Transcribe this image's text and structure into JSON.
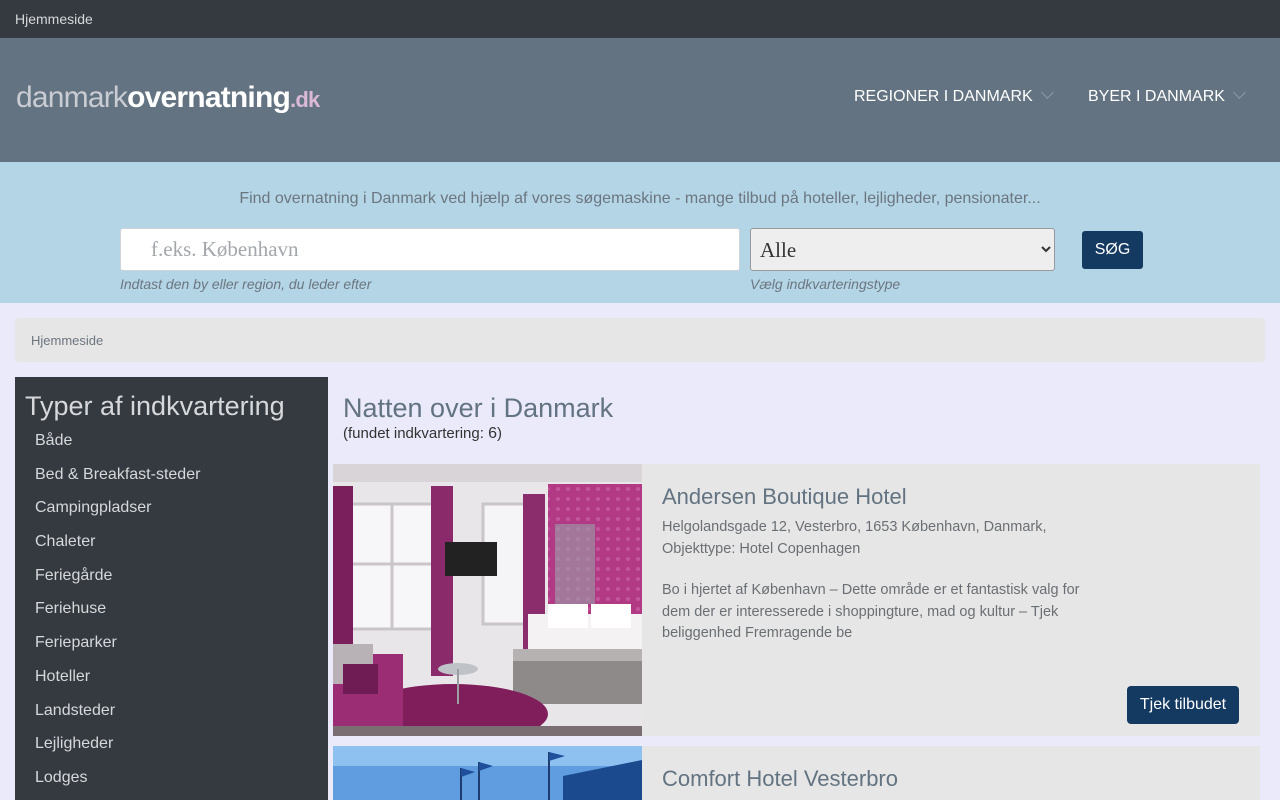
{
  "topbar": {
    "home_link": "Hjemmeside"
  },
  "header": {
    "logo": {
      "part1": "danmark",
      "part2": "overnatning",
      "part3": ".dk"
    },
    "nav": [
      {
        "label": "REGIONER I DANMARK"
      },
      {
        "label": "BYER I DANMARK"
      }
    ]
  },
  "search": {
    "tagline": "Find overnatning i Danmark ved hjælp af vores søgemaskine - mange tilbud på hoteller, lejligheder, pensionater...",
    "input_placeholder": "f.eks. København",
    "input_value": "",
    "input_hint": "Indtast den by eller region, du leder efter",
    "type_selected": "Alle",
    "type_hint": "Vælg indkvarteringstype",
    "button_label": "SØG"
  },
  "breadcrumb": {
    "current": "Hjemmeside"
  },
  "sidebar": {
    "title": "Typer af indkvartering",
    "items": [
      {
        "label": "Både"
      },
      {
        "label": "Bed & Breakfast-steder"
      },
      {
        "label": "Campingpladser"
      },
      {
        "label": "Chaleter"
      },
      {
        "label": "Feriegårde"
      },
      {
        "label": "Feriehuse"
      },
      {
        "label": "Ferieparker"
      },
      {
        "label": "Hoteller"
      },
      {
        "label": "Landsteder"
      },
      {
        "label": "Lejligheder"
      },
      {
        "label": "Lodges"
      }
    ]
  },
  "main": {
    "title": "Natten over i Danmark",
    "found_prefix": "(fundet indkvartering: ",
    "found_count": "6",
    "found_suffix": ")",
    "listings": [
      {
        "name": "Andersen Boutique Hotel",
        "address": "Helgolandsgade 12, Vesterbro, 1653 København, Danmark,",
        "type": "Objekttype: Hotel Copenhagen",
        "description": "Bo i hjertet af København – Dette område er et fantastisk valg for dem der er interesserede i shoppingture, mad og kultur – Tjek beliggenhed Fremragende be",
        "button": "Tjek tilbudet"
      },
      {
        "name": "Comfort Hotel Vesterbro"
      }
    ]
  },
  "colors": {
    "topbar": "#343a40",
    "header": "#637381",
    "search_band": "#b4d5e6",
    "button": "#153a61",
    "page_bg": "#eaeafa",
    "card_bg": "#e6e6e6"
  }
}
